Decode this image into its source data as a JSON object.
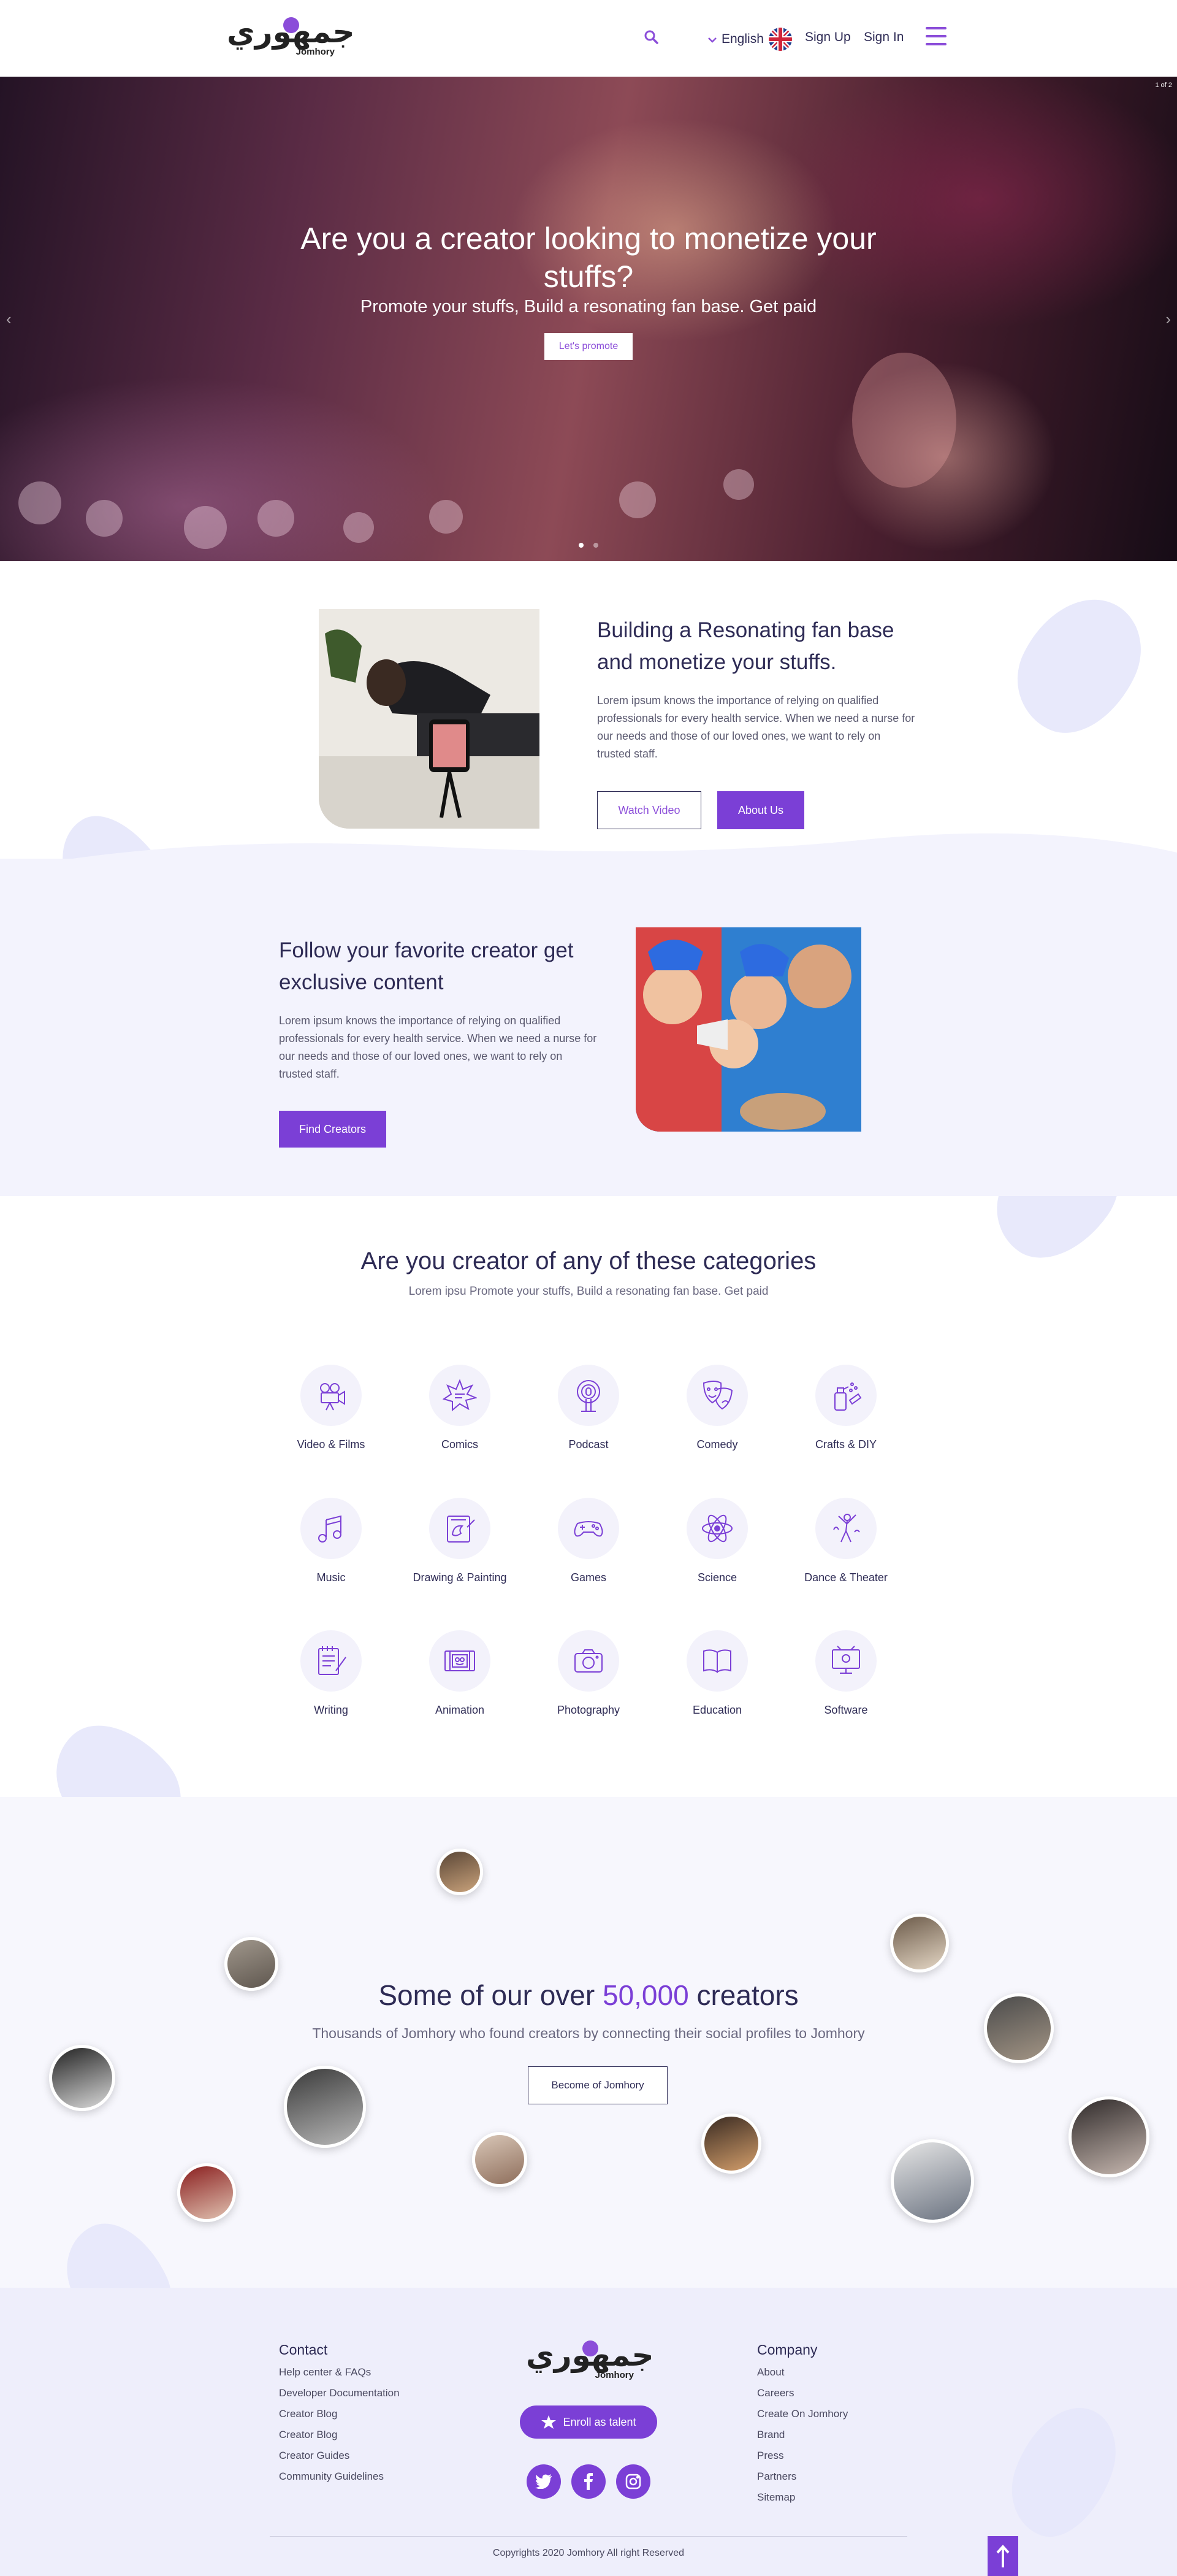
{
  "brand": {
    "logo_ar": "جمهوري",
    "logo_en": "Jomhory",
    "accent_color": "#7b3fd6"
  },
  "header": {
    "language": "English",
    "signup": "Sign Up",
    "signin": "Sign In"
  },
  "hero": {
    "counter": "1 of 2",
    "title": "Are you a creator looking to monetize your stuffs?",
    "subtitle": "Promote your stuffs, Build a resonating fan base. Get paid",
    "button": "Let's promote"
  },
  "section1": {
    "title": "Building a Resonating fan base and monetize your stuffs.",
    "body": "Lorem ipsum knows the importance of relying on qualified professionals for every health service. When we need a nurse for our needs and those of our loved ones, we want to rely on trusted staff.",
    "watch_btn": "Watch Video",
    "about_btn": "About Us"
  },
  "section2": {
    "title": "Follow your favorite creator get exclusive content",
    "body": "Lorem ipsum knows the importance of relying on qualified professionals for every health service. When we need a nurse for our needs and those of our loved ones, we want to rely on trusted staff.",
    "find_btn": "Find Creators"
  },
  "categories": {
    "title": "Are you creator of any of these categories",
    "subtitle": "Lorem ipsu Promote your stuffs, Build a resonating fan base. Get paid",
    "items": [
      {
        "label": "Video & Films",
        "icon": "video-camera-icon"
      },
      {
        "label": "Comics",
        "icon": "comics-burst-icon"
      },
      {
        "label": "Podcast",
        "icon": "podcast-icon"
      },
      {
        "label": "Comedy",
        "icon": "comedy-masks-icon"
      },
      {
        "label": "Crafts & DIY",
        "icon": "crafts-spray-icon"
      },
      {
        "label": "Music",
        "icon": "music-note-icon"
      },
      {
        "label": "Drawing & Painting",
        "icon": "drawing-tablet-icon"
      },
      {
        "label": "Games",
        "icon": "gamepad-icon"
      },
      {
        "label": "Science",
        "icon": "atom-icon"
      },
      {
        "label": "Dance & Theater",
        "icon": "dance-icon"
      },
      {
        "label": "Writing",
        "icon": "writing-notepad-icon"
      },
      {
        "label": "Animation",
        "icon": "film-strip-icon"
      },
      {
        "label": "Photography",
        "icon": "camera-icon"
      },
      {
        "label": "Education",
        "icon": "open-book-icon"
      },
      {
        "label": "Software",
        "icon": "monitor-icon"
      }
    ]
  },
  "creators": {
    "title_pre": "Some of our over ",
    "title_num": "50,000",
    "title_post": " creators",
    "subtitle": "Thousands of Jomhory who found creators by connecting their social profiles to Jomhory",
    "button": "Become of Jomhory"
  },
  "footer": {
    "contact_title": "Contact",
    "contact_links": [
      "Help center & FAQs",
      "Developer Documentation",
      "Creator Blog",
      "Creator Blog",
      "Creator Guides",
      "Community Guidelines"
    ],
    "company_title": "Company",
    "company_links": [
      "About",
      "Careers",
      "Create On Jomhory",
      "Brand",
      "Press",
      "Partners",
      "Sitemap"
    ],
    "enroll": "Enroll as talent",
    "copyright": "Copyrights 2020 Jomhory All right Reserved"
  }
}
